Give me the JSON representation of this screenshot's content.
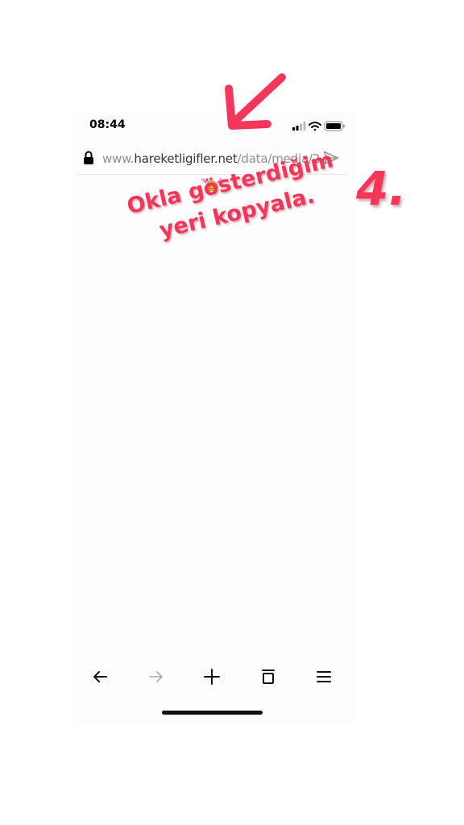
{
  "status_bar": {
    "time": "08:44"
  },
  "url_bar": {
    "url_prefix": "www.",
    "url_domain": "hareketligifler.net",
    "url_path": "/data/media/2..."
  },
  "annotation": {
    "step_number": "4.",
    "instruction_line1": "Okla gösterdiğim",
    "instruction_line2": "yeri kopyala.",
    "color": "#f4365a"
  },
  "icons": {
    "status": [
      "signal-icon",
      "wifi-icon",
      "battery-icon"
    ],
    "url_bar": [
      "lock-icon",
      "send-icon"
    ],
    "toolbar": [
      "back-icon",
      "forward-icon",
      "new-tab-icon",
      "tabs-icon",
      "menu-icon"
    ]
  }
}
